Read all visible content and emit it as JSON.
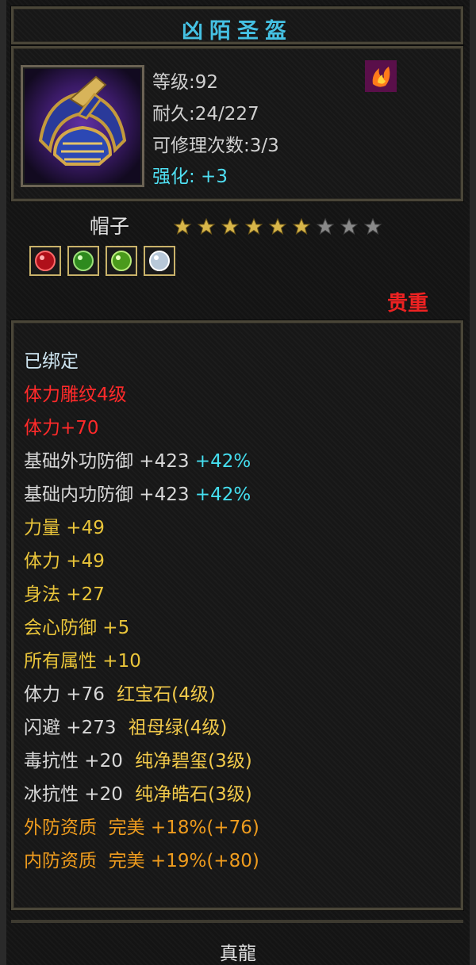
{
  "title": "凶陌圣盔",
  "stats": {
    "level": "等级:92",
    "durability": "耐久:24/227",
    "repairs": "可修理次数:3/3",
    "enhance": "强化: +3"
  },
  "item_type": "帽子",
  "stars": {
    "filled": 6,
    "total": 9
  },
  "gems": [
    "red-gem-icon",
    "green-gem-icon",
    "green-gem-icon",
    "white-gem-icon"
  ],
  "precious_label": "贵重",
  "bound": "已绑定",
  "engrave": "体力雕纹4级",
  "engrave_bonus": "体力+70",
  "base_attrs": [
    {
      "label": "基础外功防御 +423",
      "pct": "+42%"
    },
    {
      "label": "基础内功防御 +423",
      "pct": "+42%"
    }
  ],
  "attrs": [
    "力量 +49",
    "体力 +49",
    "身法 +27",
    "会心防御 +5",
    "所有属性 +10"
  ],
  "gem_attrs": [
    {
      "label": "体力 +76",
      "gem": "红宝石(4级)"
    },
    {
      "label": "闪避 +273",
      "gem": "祖母绿(4级)"
    },
    {
      "label": "毒抗性 +20",
      "gem": "纯净碧玺(3级)"
    },
    {
      "label": "冰抗性 +20",
      "gem": "纯净皓石(3级)"
    }
  ],
  "quality": [
    "外防资质  完美 +18%(+76)",
    "内防资质  完美 +19%(+80)"
  ],
  "bottom": "真龍",
  "colors": {
    "title": "#45c1e3",
    "red": "#ff2a2a",
    "yellow": "#eac53a",
    "cyan": "#45dff0",
    "orange": "#ef9c1e"
  }
}
